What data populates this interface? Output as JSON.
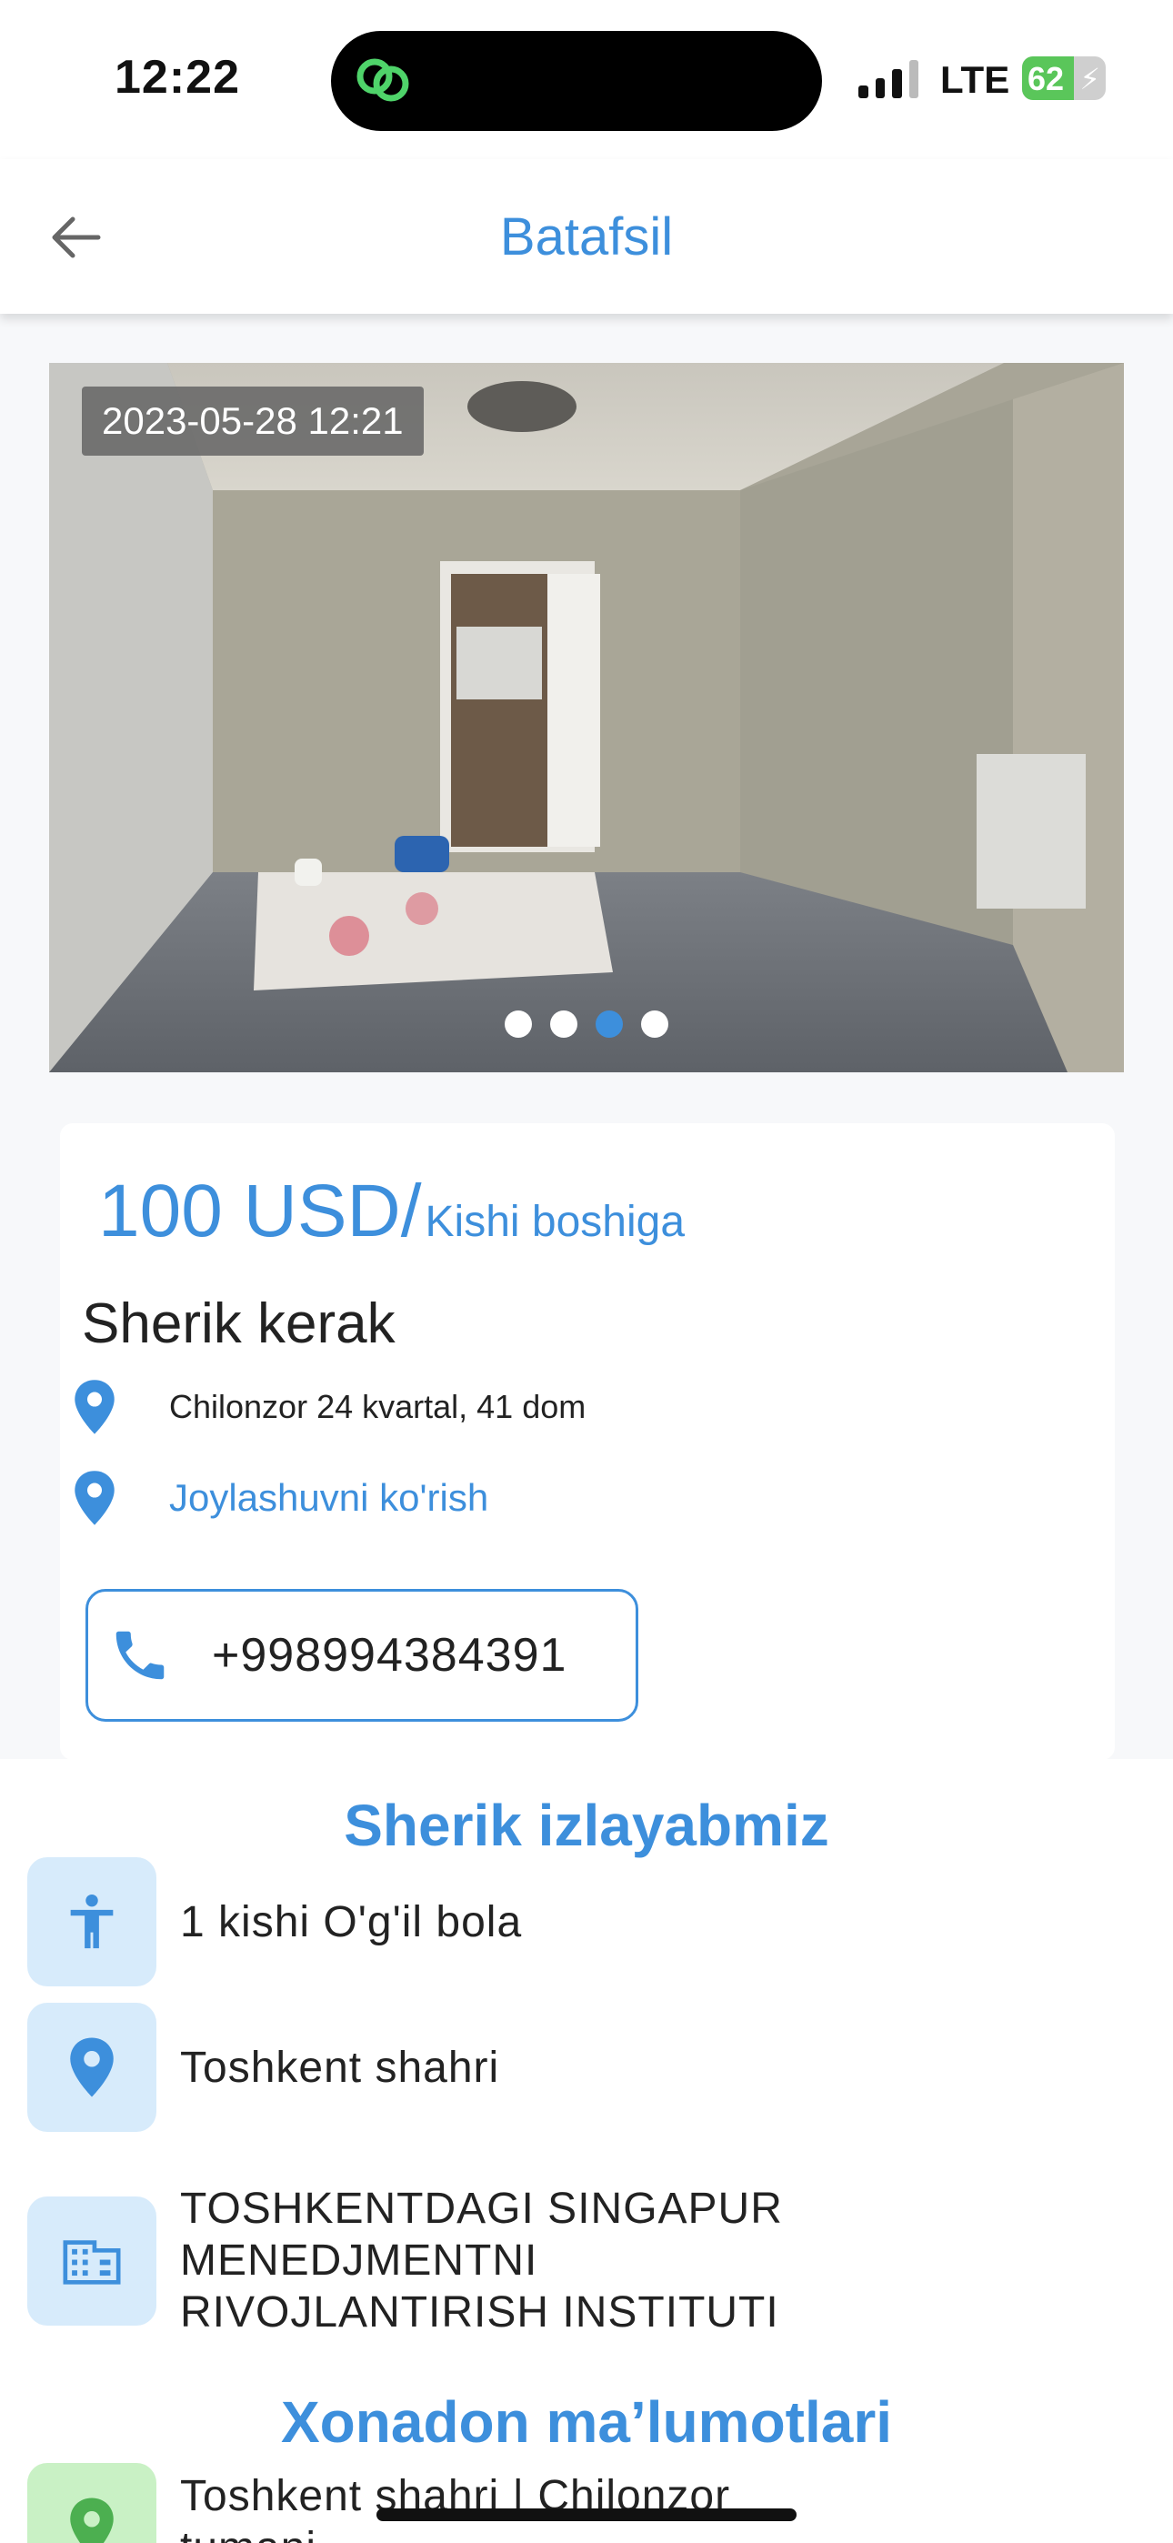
{
  "status": {
    "time": "12:22",
    "network": "LTE",
    "battery": "62",
    "battery_level": 0.62
  },
  "header": {
    "title": "Batafsil",
    "back_icon": "arrow-left-icon"
  },
  "gallery": {
    "timestamp": "2023-05-28 12:21",
    "image_count": 4,
    "active_index": 2
  },
  "listing": {
    "price": "100 USD/",
    "price_unit": "Kishi boshiga",
    "title": "Sherik kerak",
    "address": "Chilonzor 24 kvartal, 41 dom",
    "map_link": "Joylashuvni ko'rish",
    "phone": "+998994384391"
  },
  "partner_section": {
    "title": "Sherik izlayabmiz",
    "items": [
      {
        "icon": "person-icon",
        "text": "1 kishi O'g'il bola"
      },
      {
        "icon": "location-pin-icon",
        "text": "Toshkent shahri"
      },
      {
        "icon": "building-icon",
        "text": "TOSHKENTDAGI SINGAPUR MENEDJMENTNI RIVOJLANTIRISH INSTITUTI"
      }
    ]
  },
  "home_section": {
    "title": "Xonadon ma’lumotlari",
    "items": [
      {
        "icon": "location-pin-icon",
        "text": "Toshkent shahri | Chilonzor tumani"
      }
    ]
  },
  "colors": {
    "accent": "#3d8fdc",
    "icon_bg_blue": "#d7ebfb",
    "icon_bg_green": "#c9f1c5",
    "pin_green": "#4caf50"
  }
}
